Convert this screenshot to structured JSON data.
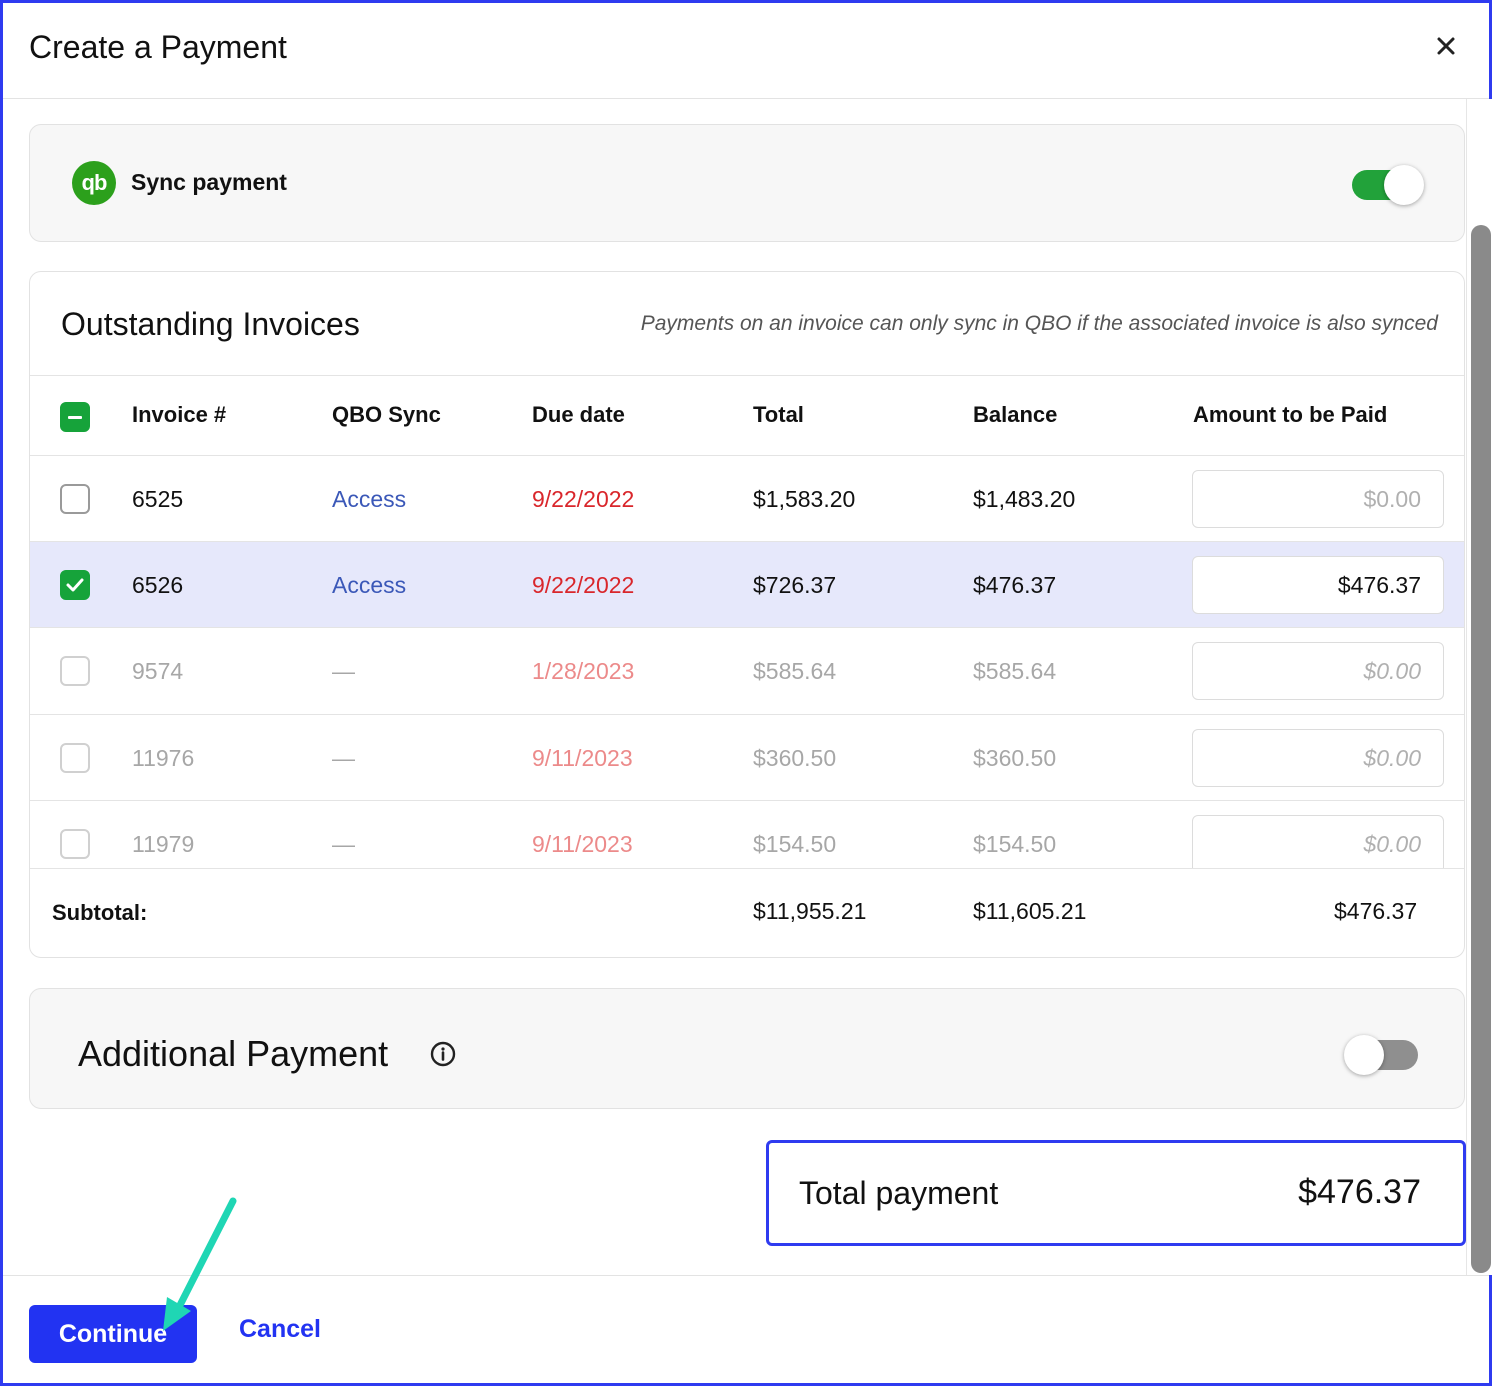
{
  "dialog": {
    "title": "Create a Payment",
    "close_icon": "close-icon"
  },
  "sync": {
    "logo_text": "qb",
    "label": "Sync payment",
    "enabled": true
  },
  "invoices": {
    "title": "Outstanding Invoices",
    "note": "Payments on an invoice can only sync in QBO if the associated invoice is also synced",
    "headers": {
      "invoice": "Invoice #",
      "qbo_sync": "QBO Sync",
      "due_date": "Due date",
      "total": "Total",
      "balance": "Balance",
      "amount": "Amount to be Paid"
    },
    "rows": [
      {
        "invoice": "6525",
        "qbo_sync": "Access",
        "due_date": "9/22/2022",
        "total": "$1,583.20",
        "balance": "$1,483.20",
        "amount": "",
        "placeholder": "$0.00",
        "checked": false
      },
      {
        "invoice": "6526",
        "qbo_sync": "Access",
        "due_date": "9/22/2022",
        "total": "$726.37",
        "balance": "$476.37",
        "amount": "$476.37",
        "placeholder": "$0.00",
        "checked": true
      },
      {
        "invoice": "9574",
        "qbo_sync": "—",
        "due_date": "1/28/2023",
        "total": "$585.64",
        "balance": "$585.64",
        "amount": "",
        "placeholder": "$0.00",
        "checked": false
      },
      {
        "invoice": "11976",
        "qbo_sync": "—",
        "due_date": "9/11/2023",
        "total": "$360.50",
        "balance": "$360.50",
        "amount": "",
        "placeholder": "$0.00",
        "checked": false
      },
      {
        "invoice": "11979",
        "qbo_sync": "—",
        "due_date": "9/11/2023",
        "total": "$154.50",
        "balance": "$154.50",
        "amount": "",
        "placeholder": "$0.00",
        "checked": false
      }
    ],
    "subtotal": {
      "label": "Subtotal:",
      "total": "$11,955.21",
      "balance": "$11,605.21",
      "amount": "$476.37"
    }
  },
  "additional_payment": {
    "title": "Additional Payment",
    "info_icon": "info-icon",
    "enabled": false
  },
  "total_payment": {
    "label": "Total payment",
    "value": "$476.37"
  },
  "footer": {
    "continue_label": "Continue",
    "cancel_label": "Cancel"
  },
  "colors": {
    "primary": "#2233f2",
    "sync_green": "#2ca01c",
    "checkbox_green": "#16a33a",
    "due_date_red": "#d9262b",
    "link_blue": "#3b58b8",
    "annotation_arrow": "#1fd6b4"
  }
}
